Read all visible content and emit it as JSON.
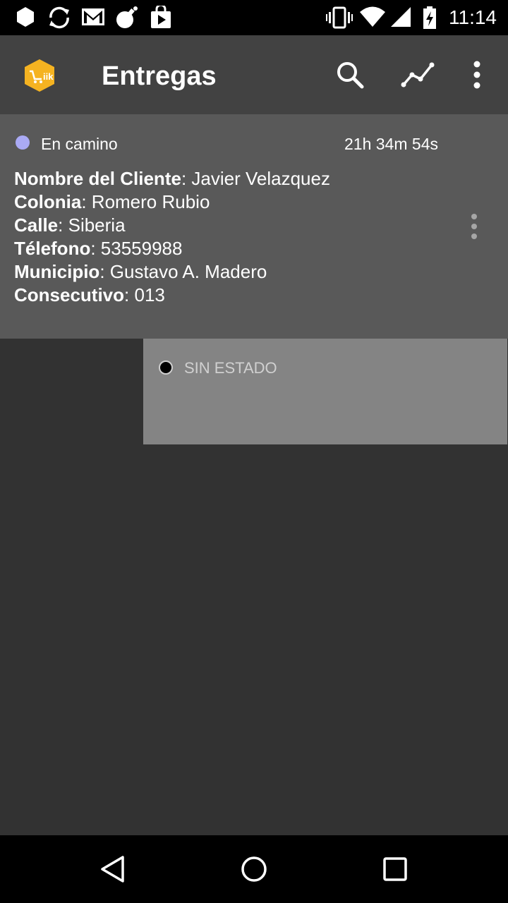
{
  "status_bar": {
    "time": "11:14",
    "icons": [
      "hexagon-icon",
      "sync-icon",
      "gmail-icon",
      "bomb-icon",
      "play-store-icon",
      "vibrate-icon",
      "wifi-icon",
      "signal-icon",
      "battery-charging-icon"
    ]
  },
  "app_bar": {
    "title": "Entregas",
    "logo_text": "iik",
    "logo_color": "#f5b321",
    "actions": [
      "search-icon",
      "chart-icon",
      "overflow-menu-icon"
    ]
  },
  "delivery": {
    "status": "En camino",
    "status_color": "#aaaaf5",
    "elapsed": "21h 34m 54s",
    "fields": [
      {
        "label": "Nombre del Cliente",
        "value": ": Javier Velazquez"
      },
      {
        "label": "Colonia",
        "value": ": Romero Rubio"
      },
      {
        "label": "Calle",
        "value": ": Siberia"
      },
      {
        "label": "Télefono",
        "value": ": 53559988"
      },
      {
        "label": "Municipio",
        "value": ": Gustavo A. Madero"
      },
      {
        "label": "Consecutivo",
        "value": ": 013"
      }
    ]
  },
  "status_menu": {
    "options": [
      {
        "label": "SIN ESTADO",
        "color": "#000000"
      }
    ]
  },
  "nav_bar": {
    "buttons": [
      "back-icon",
      "home-icon",
      "recents-icon"
    ]
  }
}
